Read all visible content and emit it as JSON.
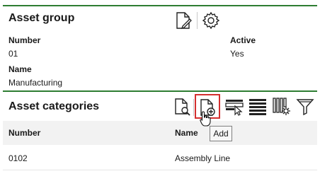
{
  "asset_group": {
    "title": "Asset group",
    "number_label": "Number",
    "number_value": "01",
    "active_label": "Active",
    "active_value": "Yes",
    "name_label": "Name",
    "name_value": "Manufacturing",
    "icons": [
      "edit-document-icon",
      "gear-icon"
    ]
  },
  "asset_categories": {
    "title": "Asset categories",
    "toolbar_icons": [
      "search-document-icon",
      "add-document-icon",
      "select-row-icon",
      "list-view-icon",
      "column-settings-icon",
      "filter-icon"
    ],
    "tooltip": "Add",
    "columns": [
      "Number",
      "Name"
    ],
    "rows": [
      {
        "number": "0102",
        "name": "Assembly Line"
      }
    ]
  },
  "colors": {
    "accent_line": "#2e7d32",
    "highlight_border": "#d32f2f"
  }
}
